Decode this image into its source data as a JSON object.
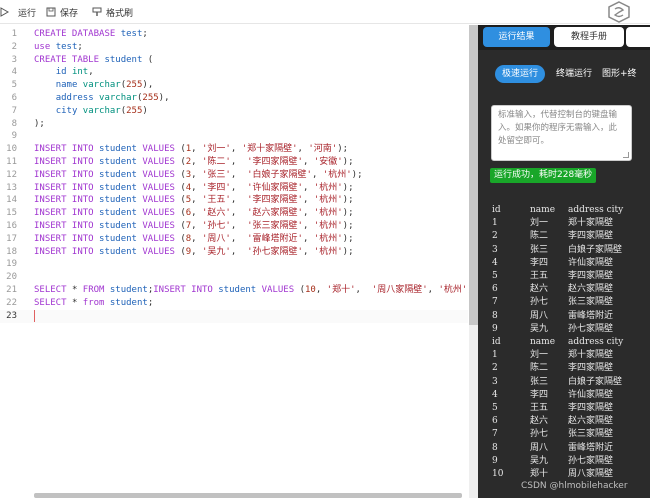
{
  "toolbar": {
    "run_label": "运行",
    "save_label": "保存",
    "format_label": "格式刷"
  },
  "editor": {
    "lines": [
      {
        "n": "1",
        "tokens": [
          [
            "kw",
            "CREATE DATABASE "
          ],
          [
            "id",
            "test"
          ],
          [
            "pn",
            ";"
          ]
        ]
      },
      {
        "n": "2",
        "tokens": [
          [
            "kw",
            "use "
          ],
          [
            "id",
            "test"
          ],
          [
            "pn",
            ";"
          ]
        ]
      },
      {
        "n": "3",
        "tokens": [
          [
            "kw",
            "CREATE TABLE "
          ],
          [
            "id",
            "student"
          ],
          [
            "pn",
            " ("
          ]
        ]
      },
      {
        "n": "4",
        "tokens": [
          [
            "pn",
            "    "
          ],
          [
            "id",
            "id "
          ],
          [
            "tp",
            "int"
          ],
          [
            "pn",
            ","
          ]
        ]
      },
      {
        "n": "5",
        "tokens": [
          [
            "pn",
            "    "
          ],
          [
            "id",
            "name "
          ],
          [
            "tp",
            "varchar"
          ],
          [
            "pn",
            "("
          ],
          [
            "nm",
            "255"
          ],
          [
            "pn",
            "),"
          ]
        ]
      },
      {
        "n": "6",
        "tokens": [
          [
            "pn",
            "    "
          ],
          [
            "id",
            "address "
          ],
          [
            "tp",
            "varchar"
          ],
          [
            "pn",
            "("
          ],
          [
            "nm",
            "255"
          ],
          [
            "pn",
            "),"
          ]
        ]
      },
      {
        "n": "7",
        "tokens": [
          [
            "pn",
            "    "
          ],
          [
            "id",
            "city "
          ],
          [
            "tp",
            "varchar"
          ],
          [
            "pn",
            "("
          ],
          [
            "nm",
            "255"
          ],
          [
            "pn",
            ")"
          ]
        ]
      },
      {
        "n": "8",
        "tokens": [
          [
            "pn",
            ");"
          ]
        ]
      },
      {
        "n": "9",
        "tokens": []
      },
      {
        "n": "10",
        "tokens": [
          [
            "kw",
            "INSERT INTO "
          ],
          [
            "id",
            "student "
          ],
          [
            "kw",
            "VALUES "
          ],
          [
            "pn",
            "("
          ],
          [
            "nm",
            "1"
          ],
          [
            "pn",
            ", "
          ],
          [
            "st",
            "'刘一'"
          ],
          [
            "pn",
            ", "
          ],
          [
            "st",
            "'郑十家隔壁'"
          ],
          [
            "pn",
            ", "
          ],
          [
            "st",
            "'河南'"
          ],
          [
            "pn",
            ");"
          ]
        ]
      },
      {
        "n": "11",
        "tokens": [
          [
            "kw",
            "INSERT INTO "
          ],
          [
            "id",
            "student "
          ],
          [
            "kw",
            "VALUES "
          ],
          [
            "pn",
            "("
          ],
          [
            "nm",
            "2"
          ],
          [
            "pn",
            ", "
          ],
          [
            "st",
            "'陈二'"
          ],
          [
            "pn",
            ",  "
          ],
          [
            "st",
            "'李四家隔壁'"
          ],
          [
            "pn",
            ", "
          ],
          [
            "st",
            "'安徽'"
          ],
          [
            "pn",
            ");"
          ]
        ]
      },
      {
        "n": "12",
        "tokens": [
          [
            "kw",
            "INSERT INTO "
          ],
          [
            "id",
            "student "
          ],
          [
            "kw",
            "VALUES "
          ],
          [
            "pn",
            "("
          ],
          [
            "nm",
            "3"
          ],
          [
            "pn",
            ", "
          ],
          [
            "st",
            "'张三'"
          ],
          [
            "pn",
            ",  "
          ],
          [
            "st",
            "'白娘子家隔壁'"
          ],
          [
            "pn",
            ", "
          ],
          [
            "st",
            "'杭州'"
          ],
          [
            "pn",
            ");"
          ]
        ]
      },
      {
        "n": "13",
        "tokens": [
          [
            "kw",
            "INSERT INTO "
          ],
          [
            "id",
            "student "
          ],
          [
            "kw",
            "VALUES "
          ],
          [
            "pn",
            "("
          ],
          [
            "nm",
            "4"
          ],
          [
            "pn",
            ", "
          ],
          [
            "st",
            "'李四'"
          ],
          [
            "pn",
            ",  "
          ],
          [
            "st",
            "'许仙家隔壁'"
          ],
          [
            "pn",
            ", "
          ],
          [
            "st",
            "'杭州'"
          ],
          [
            "pn",
            ");"
          ]
        ]
      },
      {
        "n": "14",
        "tokens": [
          [
            "kw",
            "INSERT INTO "
          ],
          [
            "id",
            "student "
          ],
          [
            "kw",
            "VALUES "
          ],
          [
            "pn",
            "("
          ],
          [
            "nm",
            "5"
          ],
          [
            "pn",
            ", "
          ],
          [
            "st",
            "'王五'"
          ],
          [
            "pn",
            ",  "
          ],
          [
            "st",
            "'李四家隔壁'"
          ],
          [
            "pn",
            ", "
          ],
          [
            "st",
            "'杭州'"
          ],
          [
            "pn",
            ");"
          ]
        ]
      },
      {
        "n": "15",
        "tokens": [
          [
            "kw",
            "INSERT INTO "
          ],
          [
            "id",
            "student "
          ],
          [
            "kw",
            "VALUES "
          ],
          [
            "pn",
            "("
          ],
          [
            "nm",
            "6"
          ],
          [
            "pn",
            ", "
          ],
          [
            "st",
            "'赵六'"
          ],
          [
            "pn",
            ",  "
          ],
          [
            "st",
            "'赵六家隔壁'"
          ],
          [
            "pn",
            ", "
          ],
          [
            "st",
            "'杭州'"
          ],
          [
            "pn",
            ");"
          ]
        ]
      },
      {
        "n": "16",
        "tokens": [
          [
            "kw",
            "INSERT INTO "
          ],
          [
            "id",
            "student "
          ],
          [
            "kw",
            "VALUES "
          ],
          [
            "pn",
            "("
          ],
          [
            "nm",
            "7"
          ],
          [
            "pn",
            ", "
          ],
          [
            "st",
            "'孙七'"
          ],
          [
            "pn",
            ",  "
          ],
          [
            "st",
            "'张三家隔壁'"
          ],
          [
            "pn",
            ", "
          ],
          [
            "st",
            "'杭州'"
          ],
          [
            "pn",
            ");"
          ]
        ]
      },
      {
        "n": "17",
        "tokens": [
          [
            "kw",
            "INSERT INTO "
          ],
          [
            "id",
            "student "
          ],
          [
            "kw",
            "VALUES "
          ],
          [
            "pn",
            "("
          ],
          [
            "nm",
            "8"
          ],
          [
            "pn",
            ", "
          ],
          [
            "st",
            "'周八'"
          ],
          [
            "pn",
            ",  "
          ],
          [
            "st",
            "'雷峰塔附近'"
          ],
          [
            "pn",
            ", "
          ],
          [
            "st",
            "'杭州'"
          ],
          [
            "pn",
            ");"
          ]
        ]
      },
      {
        "n": "18",
        "tokens": [
          [
            "kw",
            "INSERT INTO "
          ],
          [
            "id",
            "student "
          ],
          [
            "kw",
            "VALUES "
          ],
          [
            "pn",
            "("
          ],
          [
            "nm",
            "9"
          ],
          [
            "pn",
            ", "
          ],
          [
            "st",
            "'吴九'"
          ],
          [
            "pn",
            ",  "
          ],
          [
            "st",
            "'孙七家隔壁'"
          ],
          [
            "pn",
            ", "
          ],
          [
            "st",
            "'杭州'"
          ],
          [
            "pn",
            ");"
          ]
        ]
      },
      {
        "n": "19",
        "tokens": []
      },
      {
        "n": "20",
        "tokens": []
      },
      {
        "n": "21",
        "tokens": [
          [
            "kw",
            "SELECT "
          ],
          [
            "pn",
            "* "
          ],
          [
            "kw",
            "FROM "
          ],
          [
            "id",
            "student"
          ],
          [
            "pn",
            ";"
          ],
          [
            "kw",
            "INSERT INTO "
          ],
          [
            "id",
            "student "
          ],
          [
            "kw",
            "VALUES "
          ],
          [
            "pn",
            "("
          ],
          [
            "nm",
            "10"
          ],
          [
            "pn",
            ", "
          ],
          [
            "st",
            "'郑十'"
          ],
          [
            "pn",
            ",  "
          ],
          [
            "st",
            "'周八家隔壁'"
          ],
          [
            "pn",
            ", "
          ],
          [
            "st",
            "'杭州'"
          ],
          [
            "pn",
            ");"
          ]
        ]
      },
      {
        "n": "22",
        "tokens": [
          [
            "kw",
            "SELECT "
          ],
          [
            "pn",
            "* "
          ],
          [
            "kw",
            "from "
          ],
          [
            "id",
            "student"
          ],
          [
            "pn",
            ";"
          ]
        ]
      },
      {
        "n": "23",
        "tokens": []
      }
    ]
  },
  "panel": {
    "tabs": [
      "运行结果",
      "教程手册"
    ],
    "subtabs": [
      "极速运行",
      "终端运行",
      "图形+终"
    ],
    "stdin_placeholder": "标准输入，代替控制台的键盘输入。如果你的程序无需输入，此处留空即可。",
    "status": "运行成功，耗时228毫秒",
    "result_header": [
      "id",
      "name",
      "address city"
    ],
    "result1": [
      [
        "1",
        "刘一",
        "郑十家隔壁"
      ],
      [
        "2",
        "陈二",
        "李四家隔壁"
      ],
      [
        "3",
        "张三",
        "白娘子家隔壁"
      ],
      [
        "4",
        "李四",
        "许仙家隔壁"
      ],
      [
        "5",
        "王五",
        "李四家隔壁"
      ],
      [
        "6",
        "赵六",
        "赵六家隔壁"
      ],
      [
        "7",
        "孙七",
        "张三家隔壁"
      ],
      [
        "8",
        "周八",
        "雷峰塔附近"
      ],
      [
        "9",
        "吴九",
        "孙七家隔壁"
      ]
    ],
    "result2": [
      [
        "1",
        "刘一",
        "郑十家隔壁"
      ],
      [
        "2",
        "陈二",
        "李四家隔壁"
      ],
      [
        "3",
        "张三",
        "白娘子家隔壁"
      ],
      [
        "4",
        "李四",
        "许仙家隔壁"
      ],
      [
        "5",
        "王五",
        "李四家隔壁"
      ],
      [
        "6",
        "赵六",
        "赵六家隔壁"
      ],
      [
        "7",
        "孙七",
        "张三家隔壁"
      ],
      [
        "8",
        "周八",
        "雷峰塔附近"
      ],
      [
        "9",
        "吴九",
        "孙七家隔壁"
      ],
      [
        "10",
        "郑十",
        "周八家隔壁"
      ]
    ]
  },
  "watermark": "CSDN @hlmobilehacker"
}
